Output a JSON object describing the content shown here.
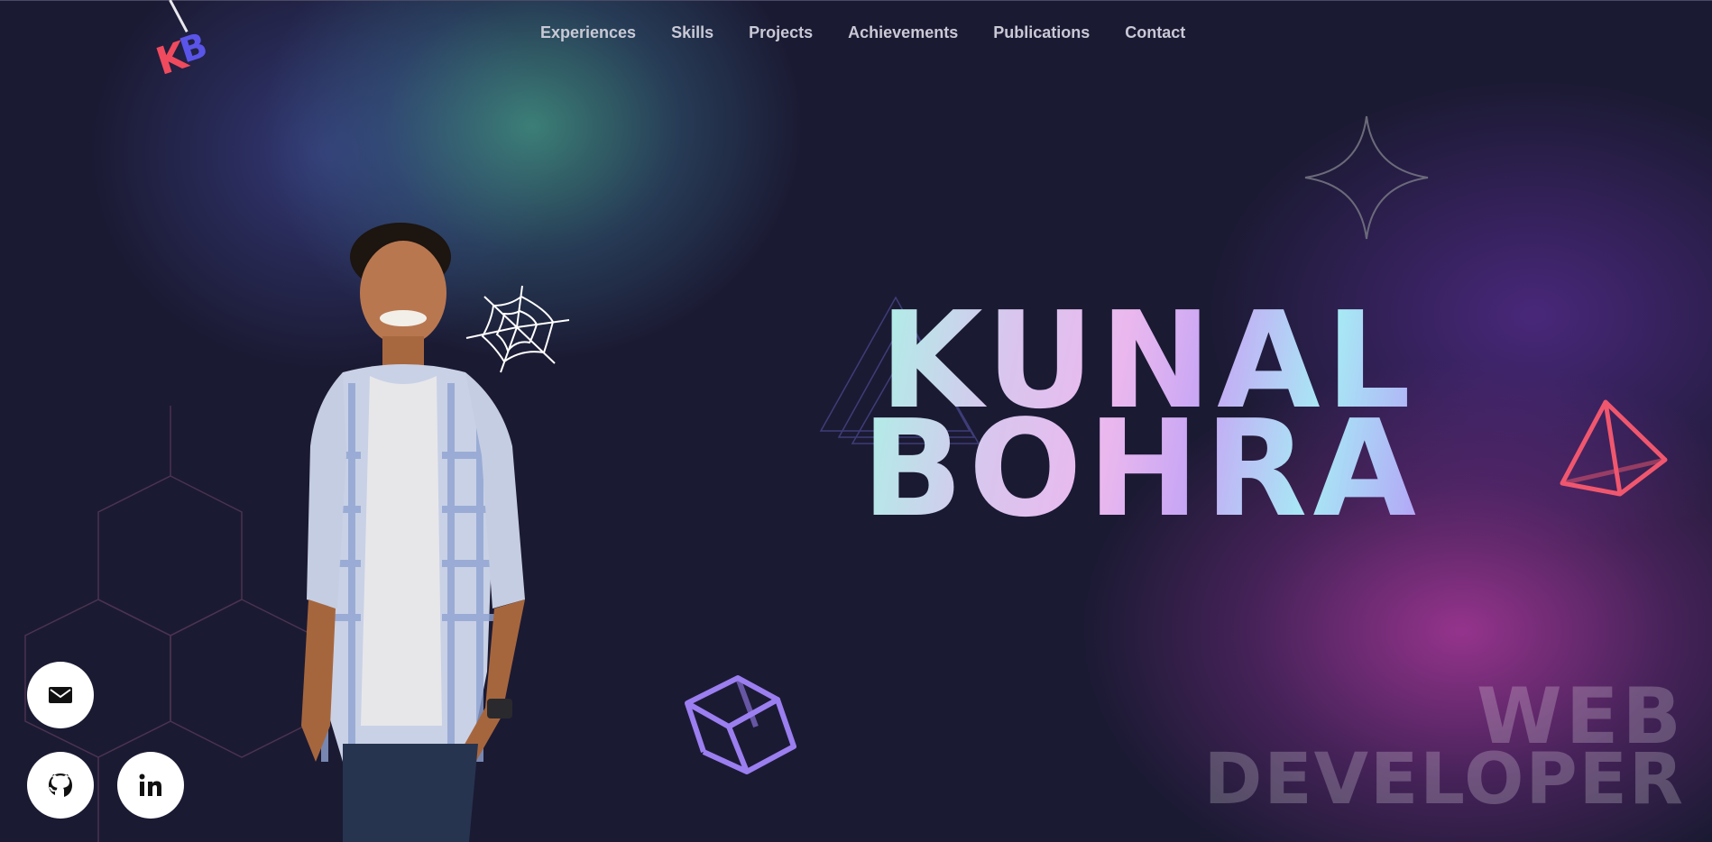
{
  "logo": {
    "letter1": "K",
    "letter2": "B"
  },
  "nav": {
    "items": [
      "Experiences",
      "Skills",
      "Projects",
      "Achievements",
      "Publications",
      "Contact"
    ]
  },
  "hero": {
    "first_name": "KUNAL",
    "last_name": "BOHRA",
    "role_line1": "WEB",
    "role_line2": "DEVELOPER"
  },
  "social": {
    "icons": [
      "mail-icon",
      "github-icon",
      "linkedin-icon"
    ]
  },
  "colors": {
    "background": "#1b1a33",
    "logo_k": "#f04a5e",
    "logo_b": "#5a55e8",
    "pyramid": "#f0576e",
    "cube": "#9b7ef0"
  }
}
